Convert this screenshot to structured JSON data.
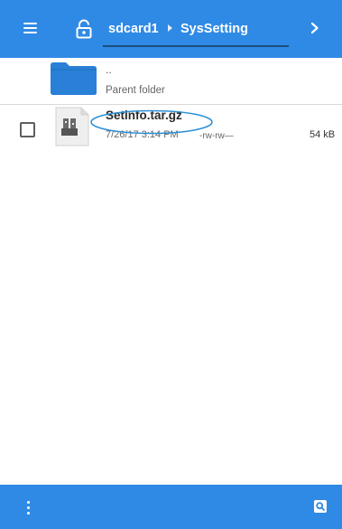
{
  "toolbar": {
    "menu_icon": "hamburger-menu-icon",
    "lock_icon": "lock-open-icon",
    "next_icon": "chevron-right-icon"
  },
  "breadcrumb": {
    "root": "sdcard1",
    "current": "SysSetting"
  },
  "parent": {
    "name": "..",
    "label": "Parent folder"
  },
  "files": [
    {
      "name": "Setinfo.tar.gz",
      "date": "7/26/17 3:14 PM",
      "permissions": "-rw-rw—",
      "size": "54 kB",
      "checked": false,
      "icon": "archive-icon"
    }
  ],
  "bottom": {
    "more_icon": "more-vert-icon",
    "search_icon": "search-icon"
  },
  "colors": {
    "appbar": "#2f8ae5",
    "folder": "#2980d6",
    "highlight": "#2b8fd6"
  }
}
